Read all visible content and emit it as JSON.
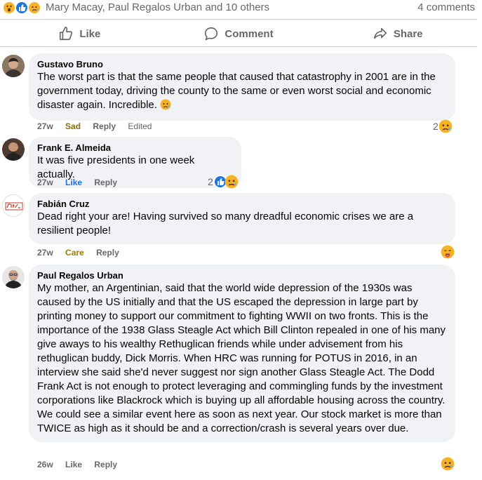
{
  "reactions_bar": {
    "icons": [
      "wow-emoji-icon",
      "like-emoji-icon",
      "sad-emoji-icon"
    ],
    "names": "Mary Macay, Paul Regalos Urban and 10 others",
    "comment_count": "4 comments"
  },
  "actions": {
    "like": "Like",
    "comment": "Comment",
    "share": "Share"
  },
  "comments": [
    {
      "author": "Gustavo Bruno",
      "text": "The worst part is that the same people that caused that catastrophy in 2001 are in the government today, driving the county to the same or even worst social and economic disaster again. Incredible.",
      "time": "27w",
      "reaction_label": "Sad",
      "reply": "Reply",
      "edited": "Edited",
      "reaction_count": "2"
    },
    {
      "author": "Frank E. Almeida",
      "text": "It was five presidents in one week actually.",
      "time": "27w",
      "reaction_label": "Like",
      "reply": "Reply",
      "reaction_count": "2"
    },
    {
      "author": "Fabián Cruz",
      "text": "Dead right your are! Having survived so many dreadful economic crises we are a resilient people!",
      "time": "27w",
      "reaction_label": "Care",
      "reply": "Reply"
    },
    {
      "author": "Paul Regalos Urban",
      "text": "My mother, an Argentinian, said that the world wide depression of the 1930s was caused by the US initially and that the US escaped the depression in large part by printing money to support our commitment to fighting WWII on two fronts. This is the importance of the 1938 Glass Steagle Act which Bill Clinton repealed in one of his many give aways to his wealthy Rethuglican friends while under advisement from his rethuglican buddy, Dick Morris. When HRC was running for POTUS in 2016, in an interview she said she'd never suggest nor sign another Glass Steagle Act. The Dodd Frank Act is not enough to protect leveraging and commingling funds by the investment corporations like Blackrock which is buying up all affordable housing across the country. We could see a similar event here as soon as next year. Our stock market is more than TWICE as high as it should be and a correction/crash is several years over due.",
      "time": "26w",
      "reaction_label": "Like",
      "reply": "Reply"
    }
  ],
  "colors": {
    "bubble": "#f0f2f5",
    "secondary_text": "#65676b",
    "like_blue": "#1b74e4",
    "sad_yellow": "#f7b125"
  }
}
